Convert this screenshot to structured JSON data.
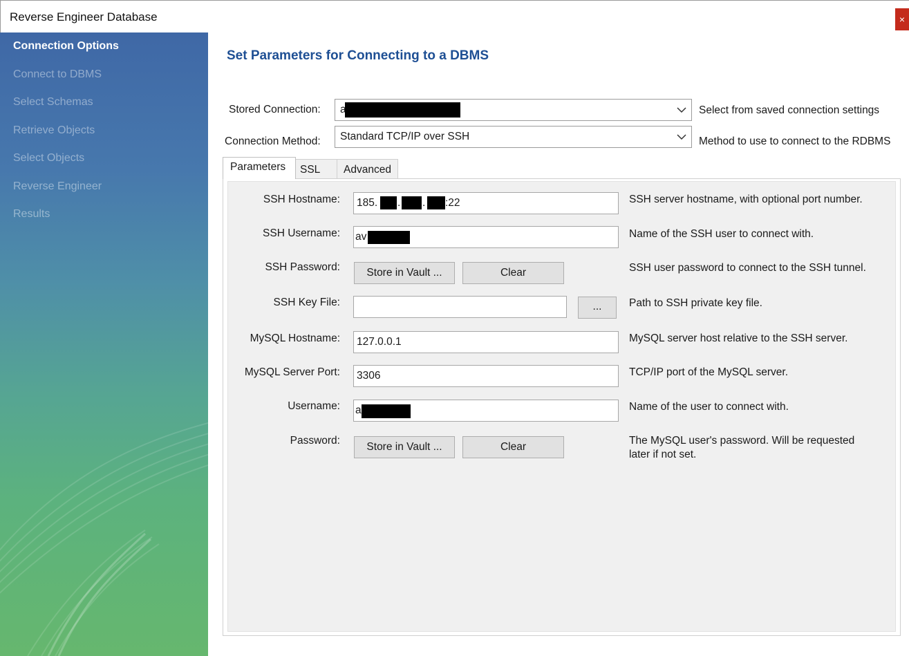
{
  "window": {
    "title": "Reverse Engineer Database",
    "close_glyph": "×"
  },
  "sidebar": {
    "steps": [
      {
        "label": "Connection Options",
        "active": true
      },
      {
        "label": "Connect to DBMS",
        "active": false
      },
      {
        "label": "Select Schemas",
        "active": false
      },
      {
        "label": "Retrieve Objects",
        "active": false
      },
      {
        "label": "Select Objects",
        "active": false
      },
      {
        "label": "Reverse Engineer",
        "active": false
      },
      {
        "label": "Results",
        "active": false
      }
    ]
  },
  "main": {
    "heading": "Set Parameters for Connecting to a DBMS",
    "stored_connection": {
      "label": "Stored Connection:",
      "value": "a",
      "description": "Select from saved connection settings"
    },
    "connection_method": {
      "label": "Connection Method:",
      "value": "Standard TCP/IP over SSH",
      "description": "Method to use to connect to the RDBMS"
    },
    "tabs": [
      {
        "label": "Parameters",
        "active": true
      },
      {
        "label": "SSL",
        "active": false
      },
      {
        "label": "Advanced",
        "active": false
      }
    ],
    "fields": {
      "ssh_hostname": {
        "label": "SSH Hostname:",
        "value_prefix": "185.",
        "sep1": ".",
        "sep2": ".",
        "value_suffix": ":22",
        "description": "SSH server hostname, with  optional port number."
      },
      "ssh_username": {
        "label": "SSH Username:",
        "value": "av",
        "description": "Name of the SSH user to connect with."
      },
      "ssh_password": {
        "label": "SSH Password:",
        "store_button": "Store in Vault ...",
        "clear_button": "Clear",
        "description": "SSH user password to connect to the SSH tunnel."
      },
      "ssh_key_file": {
        "label": "SSH Key File:",
        "value": "",
        "browse_button": "...",
        "description": "Path to SSH private key file."
      },
      "mysql_hostname": {
        "label": "MySQL Hostname:",
        "value": "127.0.0.1",
        "description": "MySQL server host relative to the SSH server."
      },
      "mysql_port": {
        "label": "MySQL Server Port:",
        "value": "3306",
        "description": "TCP/IP port of the MySQL server."
      },
      "username": {
        "label": "Username:",
        "value": "a",
        "description": "Name of the user to connect with."
      },
      "password": {
        "label": "Password:",
        "store_button": "Store in Vault ...",
        "clear_button": "Clear",
        "description": "The MySQL user's password. Will be requested later if not set."
      }
    }
  },
  "colors": {
    "heading": "#1e4f94",
    "close_button": "#c42b1c",
    "sidebar_top": "#3f68a6",
    "sidebar_bottom": "#66b76e"
  }
}
